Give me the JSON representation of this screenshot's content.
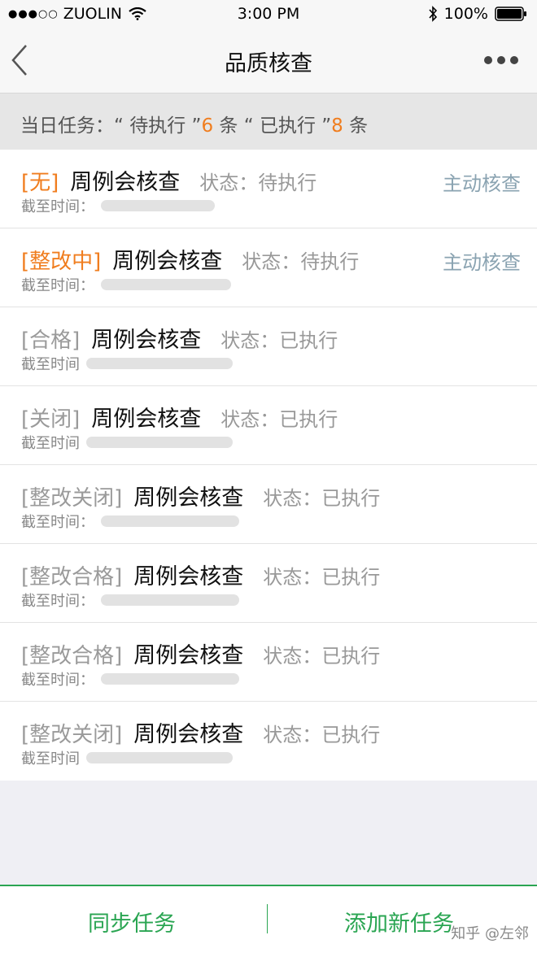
{
  "status_bar": {
    "carrier": "ZUOLIN",
    "signal_dots": "●●●○○",
    "time": "3:00 PM",
    "battery": "100%"
  },
  "nav": {
    "title": "品质核查"
  },
  "summary": {
    "prefix": "当日任务：“ 待执行 ”",
    "pending_count": "6",
    "mid": " 条 “ 已执行 ”",
    "done_count": "8",
    "suffix": " 条"
  },
  "tasks": [
    {
      "tag": "[无]",
      "name": "周例会核查",
      "status": "状态：待执行",
      "deadline_label": "截至时间：",
      "action": "主动核查"
    },
    {
      "tag": "[整改中]",
      "name": "周例会核查",
      "status": "状态：待执行",
      "deadline_label": "截至时间：",
      "action": "主动核查"
    },
    {
      "tag": "[合格]",
      "name": "周例会核查",
      "status": "状态：已执行",
      "deadline_label": "截至时间"
    },
    {
      "tag": "[关闭]",
      "name": "周例会核查",
      "status": "状态：已执行",
      "deadline_label": "截至时间"
    },
    {
      "tag": "[整改关闭]",
      "name": "周例会核查",
      "status": "状态：已执行",
      "deadline_label": "截至时间："
    },
    {
      "tag": "[整改合格]",
      "name": "周例会核查",
      "status": "状态：已执行",
      "deadline_label": "截至时间："
    },
    {
      "tag": "[整改合格]",
      "name": "周例会核查",
      "status": "状态：已执行",
      "deadline_label": "截至时间："
    },
    {
      "tag": "[整改关闭]",
      "name": "周例会核查",
      "status": "状态：已执行",
      "deadline_label": "截至时间"
    }
  ],
  "bottom": {
    "sync_label": "同步任务",
    "add_label": "添加新任务",
    "watermark": "知乎 @左邻"
  },
  "colors": {
    "accent_orange": "#f07d1e",
    "accent_green": "#2aa552",
    "link_blue_gray": "#8aa3b1"
  }
}
